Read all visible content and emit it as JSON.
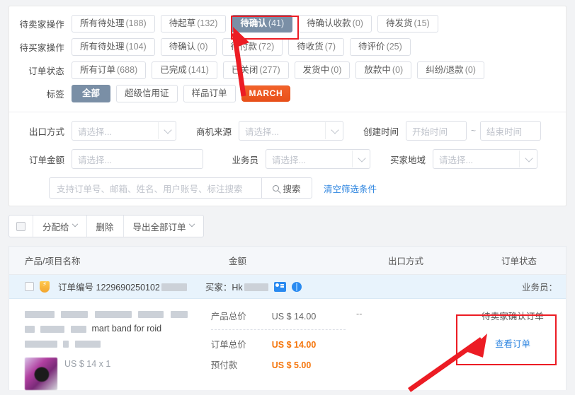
{
  "quick_filters": [
    {
      "label": "待卖家操作",
      "name": "seller-actions",
      "items": [
        {
          "text": "所有待处理",
          "count": "(188)",
          "active": false
        },
        {
          "text": "待起草",
          "count": "(132)",
          "active": false
        },
        {
          "text": "待确认",
          "count": "(41)",
          "active": true
        },
        {
          "text": "待确认收款",
          "count": "(0)",
          "active": false
        },
        {
          "text": "待发货",
          "count": "(15)",
          "active": false
        }
      ]
    },
    {
      "label": "待买家操作",
      "name": "buyer-actions",
      "items": [
        {
          "text": "所有待处理",
          "count": "(104)",
          "active": false
        },
        {
          "text": "待确认",
          "count": "(0)",
          "active": false
        },
        {
          "text": "待付款",
          "count": "(72)",
          "active": false
        },
        {
          "text": "待收货",
          "count": "(7)",
          "active": false
        },
        {
          "text": "待评价",
          "count": "(25)",
          "active": false
        }
      ]
    },
    {
      "label": "订单状态",
      "name": "order-status",
      "items": [
        {
          "text": "所有订单",
          "count": "(688)",
          "active": false
        },
        {
          "text": "已完成",
          "count": "(141)",
          "active": false
        },
        {
          "text": "已关闭",
          "count": "(277)",
          "active": false
        },
        {
          "text": "发货中",
          "count": "(0)",
          "active": false
        },
        {
          "text": "放款中",
          "count": "(0)",
          "active": false
        },
        {
          "text": "纠纷/退款",
          "count": "(0)",
          "active": false
        }
      ]
    },
    {
      "label": "标签",
      "name": "tags",
      "items": [
        {
          "text": "全部",
          "count": "",
          "active": true
        },
        {
          "text": "超级信用证",
          "count": "",
          "active": false
        },
        {
          "text": "样品订单",
          "count": "",
          "active": false
        },
        {
          "text": "MARCH",
          "count": "",
          "active": false,
          "style": "march"
        }
      ]
    }
  ],
  "advanced_filter": {
    "export_method": {
      "label": "出口方式",
      "placeholder": "请选择..."
    },
    "lead_source": {
      "label": "商机来源",
      "placeholder": "请选择..."
    },
    "create_time": {
      "label": "创建时间",
      "start_placeholder": "开始时间",
      "end_placeholder": "结束时间",
      "separator": "~"
    },
    "order_amount": {
      "label": "订单金额",
      "placeholder": "请选择..."
    },
    "salesman": {
      "label": "业务员",
      "placeholder": "请选择..."
    },
    "buyer_region": {
      "label": "买家地域",
      "placeholder": "请选择..."
    },
    "search": {
      "placeholder": "支持订单号、邮箱、姓名、用户账号、标注搜索",
      "button": "搜索",
      "icon": "search-icon"
    },
    "clear_link": "清空筛选条件"
  },
  "toolbar": {
    "assign_to": "分配给",
    "delete": "删除",
    "export_all": "导出全部订单"
  },
  "table": {
    "columns": [
      {
        "key": "name",
        "label": "产品/项目名称"
      },
      {
        "key": "amount",
        "label": "金额"
      },
      {
        "key": "export",
        "label": "出口方式"
      },
      {
        "key": "status",
        "label": "订单状态"
      }
    ],
    "order": {
      "order_no_label": "订单编号",
      "order_no": "1229690250102",
      "buyer_label": "买家：",
      "buyer_name": "Hk",
      "salesman_label": "业务员：",
      "badge_icon": "shield-lightning-icon",
      "buyer_card_icon": "buyer-card-icon",
      "buyer_globe_icon": "globe-icon",
      "product_title": "mart band for      roid",
      "qty_text": "US $ 14 x 1",
      "amounts": [
        {
          "key": "产品总价",
          "value": "US $ 14.00",
          "highlight": false
        },
        {
          "key": "订单总价",
          "value": "US $ 14.00",
          "highlight": true
        },
        {
          "key": "预付款",
          "value": "US $ 5.00",
          "highlight": true
        }
      ],
      "export_method": "--",
      "status_text": "待卖家确认订单",
      "view_order_link": "查看订单"
    }
  },
  "colors": {
    "accent_blue": "#2f86e0",
    "active_tab_bg": "#7a8fa6",
    "highlight_orange": "#f5750b",
    "march_badge": "#e8501a",
    "annotation_red": "#ec1c24",
    "order_row_bg": "#e8f3fc"
  }
}
